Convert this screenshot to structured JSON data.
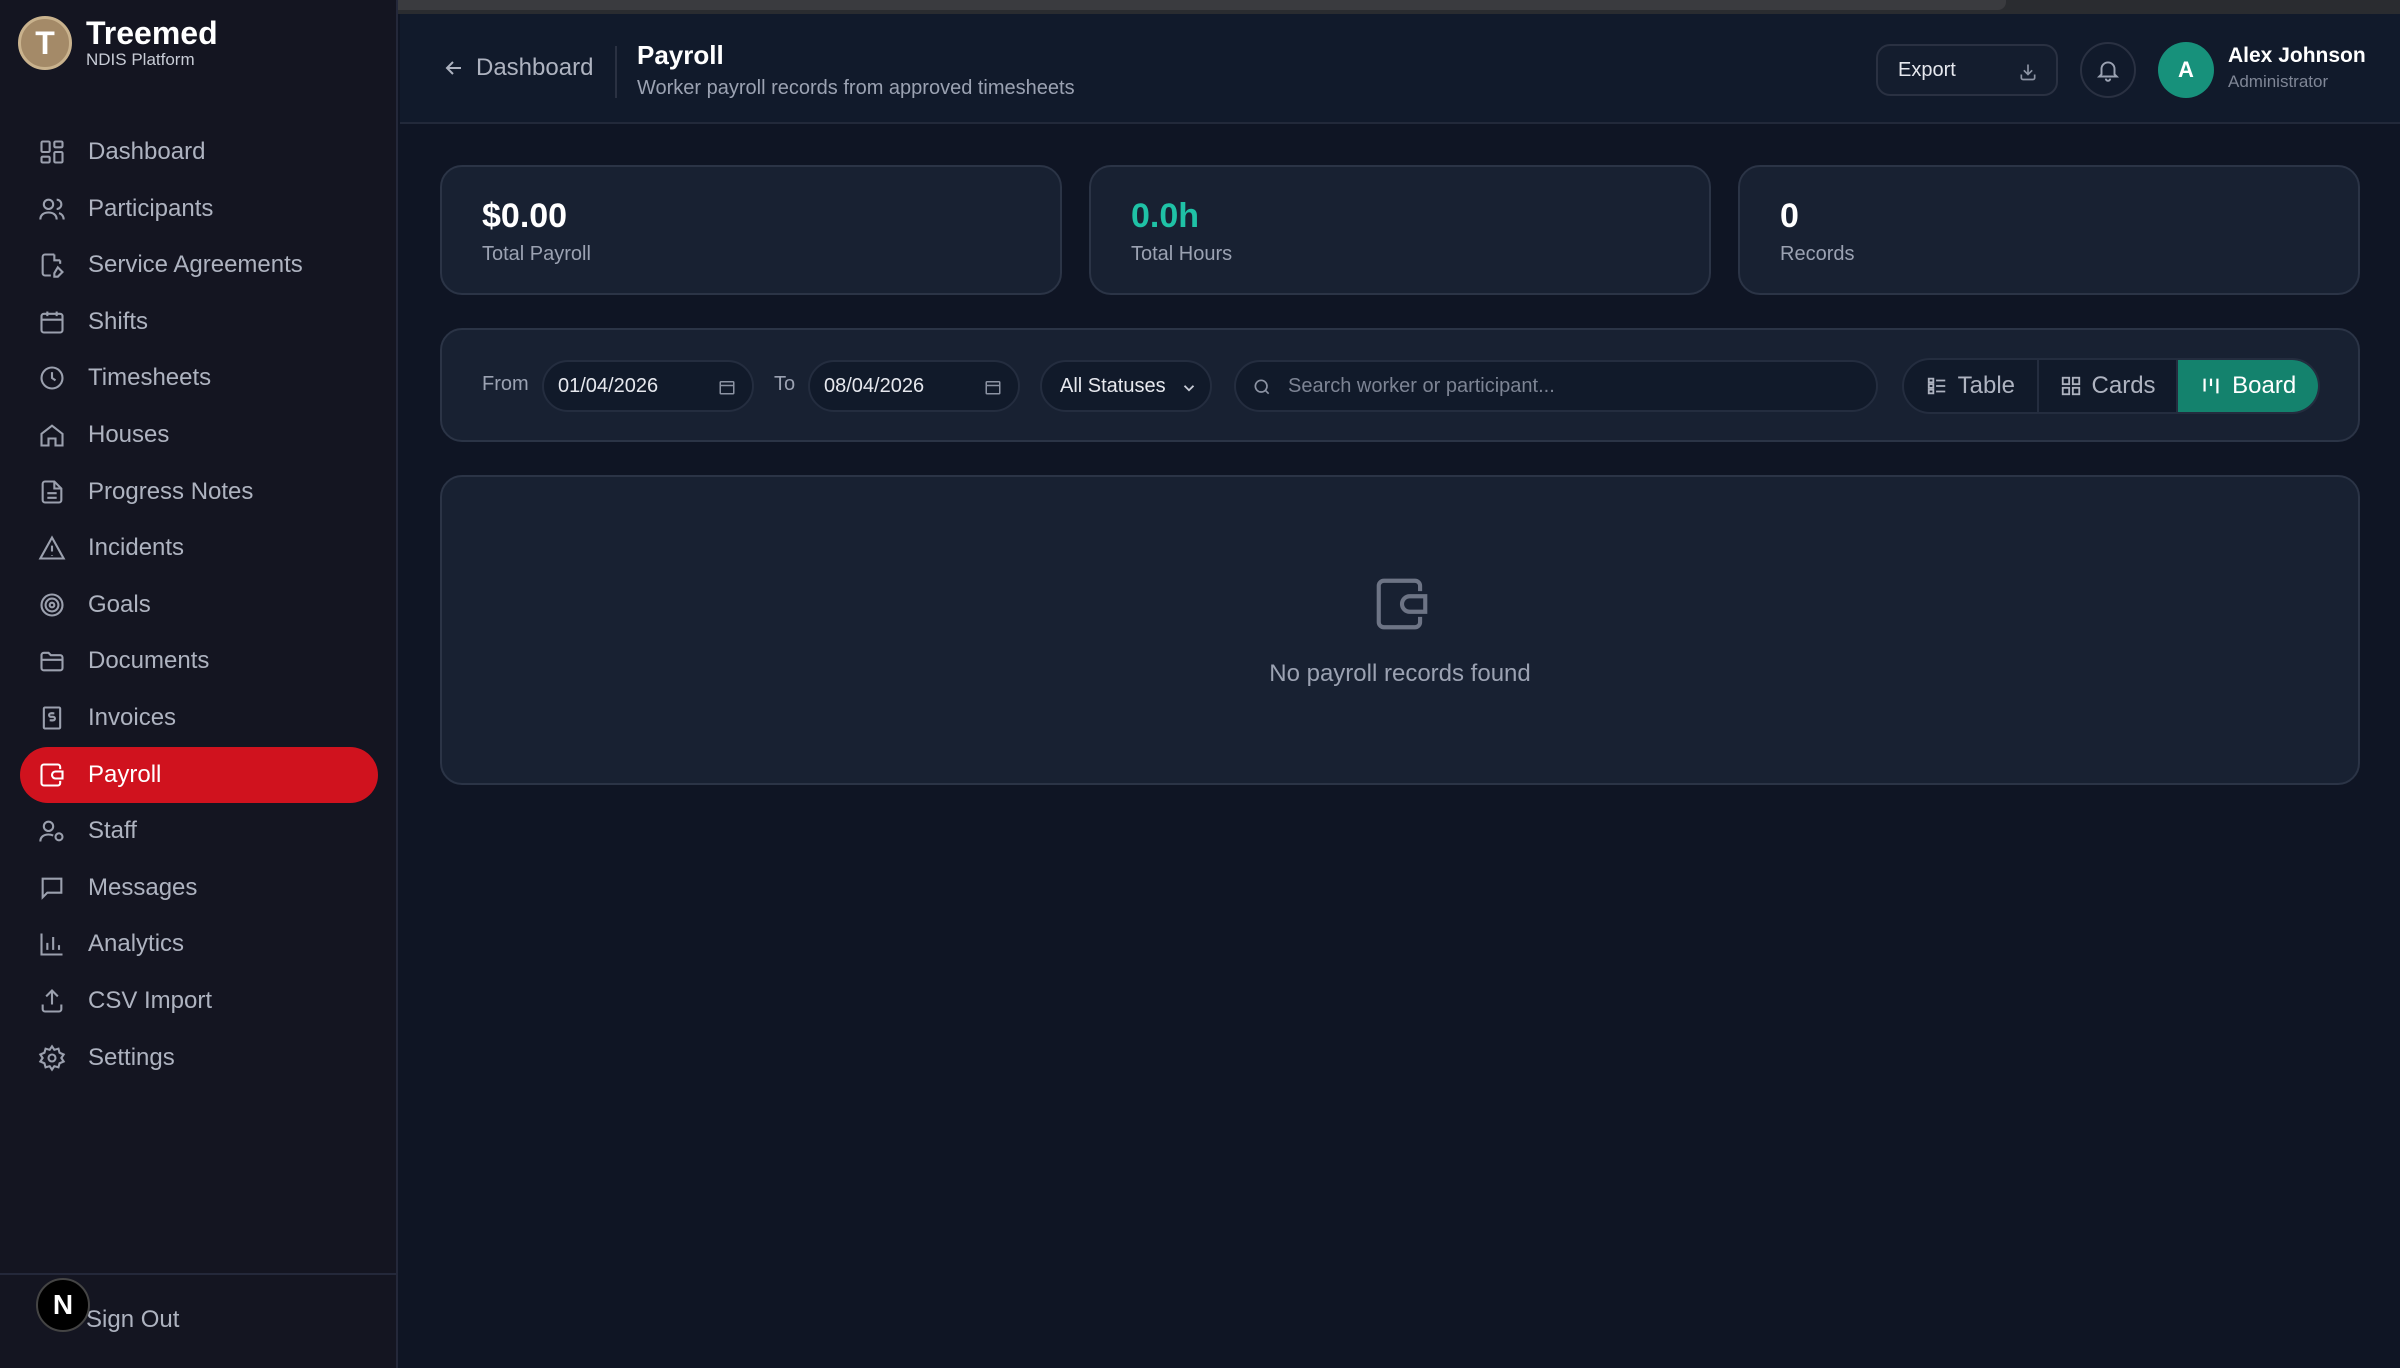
{
  "brand": {
    "logo_letter": "T",
    "name": "Treemed",
    "subtitle": "NDIS Platform"
  },
  "sidebar": {
    "items": [
      {
        "label": "Dashboard",
        "icon": "dashboard-icon"
      },
      {
        "label": "Participants",
        "icon": "users-icon"
      },
      {
        "label": "Service Agreements",
        "icon": "file-edit-icon"
      },
      {
        "label": "Shifts",
        "icon": "calendar-icon"
      },
      {
        "label": "Timesheets",
        "icon": "clock-icon"
      },
      {
        "label": "Houses",
        "icon": "home-icon"
      },
      {
        "label": "Progress Notes",
        "icon": "document-icon"
      },
      {
        "label": "Incidents",
        "icon": "warning-icon"
      },
      {
        "label": "Goals",
        "icon": "target-icon"
      },
      {
        "label": "Documents",
        "icon": "folder-icon"
      },
      {
        "label": "Invoices",
        "icon": "receipt-icon"
      },
      {
        "label": "Payroll",
        "icon": "wallet-icon",
        "active": true
      },
      {
        "label": "Staff",
        "icon": "user-cog-icon"
      },
      {
        "label": "Messages",
        "icon": "message-icon"
      },
      {
        "label": "Analytics",
        "icon": "bar-chart-icon"
      },
      {
        "label": "CSV Import",
        "icon": "upload-icon"
      },
      {
        "label": "Settings",
        "icon": "gear-icon"
      }
    ],
    "footer": {
      "badge_letter": "N",
      "sign_out": "Sign Out"
    }
  },
  "header": {
    "back_label": "Dashboard",
    "title": "Payroll",
    "subtitle": "Worker payroll records from approved timesheets",
    "export_label": "Export",
    "user": {
      "initial": "A",
      "name": "Alex Johnson",
      "role": "Administrator"
    }
  },
  "stats": [
    {
      "value": "$0.00",
      "label": "Total Payroll"
    },
    {
      "value": "0.0h",
      "label": "Total Hours"
    },
    {
      "value": "0",
      "label": "Records"
    }
  ],
  "filters": {
    "from_label": "From",
    "from_value": "01/04/2026",
    "to_label": "To",
    "to_value": "08/04/2026",
    "status_value": "All Statuses",
    "search_placeholder": "Search worker or participant...",
    "views": [
      {
        "label": "Table",
        "icon": "list-icon"
      },
      {
        "label": "Cards",
        "icon": "grid-icon"
      },
      {
        "label": "Board",
        "icon": "kanban-icon",
        "active": true
      }
    ]
  },
  "empty": {
    "message": "No payroll records found"
  },
  "colors": {
    "accent_red": "#d0121e",
    "accent_teal": "#14826d",
    "teal_text": "#1fc2a6"
  }
}
